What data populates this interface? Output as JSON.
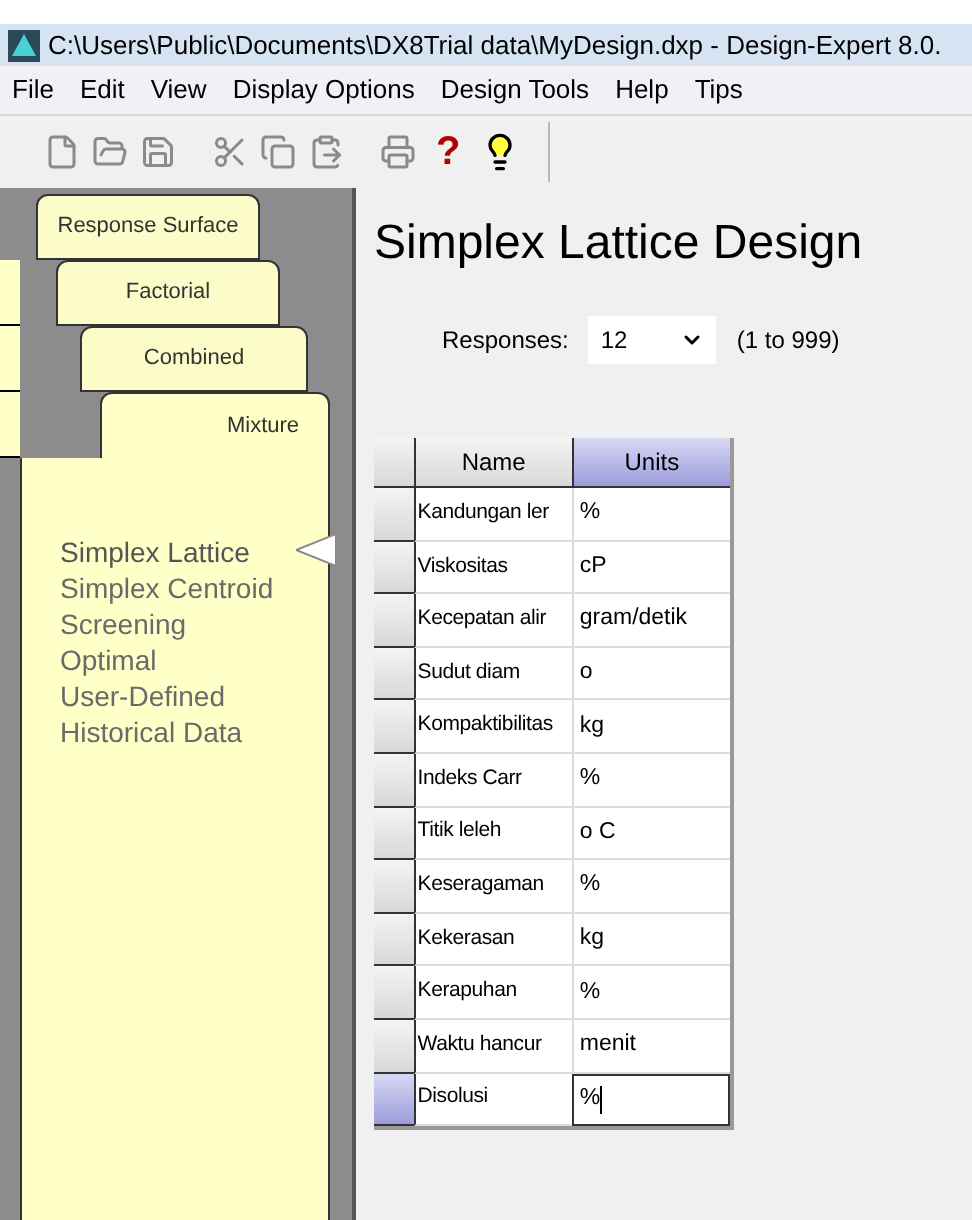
{
  "window": {
    "title": "C:\\Users\\Public\\Documents\\DX8Trial data\\MyDesign.dxp - Design-Expert 8.0."
  },
  "menu": [
    "File",
    "Edit",
    "View",
    "Display Options",
    "Design Tools",
    "Help",
    "Tips"
  ],
  "toolbar": [
    {
      "kind": "new"
    },
    {
      "kind": "open"
    },
    {
      "kind": "save"
    },
    {
      "kind": "cut"
    },
    {
      "kind": "copy"
    },
    {
      "kind": "paste"
    },
    {
      "kind": "print"
    },
    {
      "kind": "help",
      "label": "?"
    },
    {
      "kind": "tip"
    }
  ],
  "tabs": [
    {
      "label": "Response Surface",
      "selected": false
    },
    {
      "label": "Factorial",
      "selected": false
    },
    {
      "label": "Combined",
      "selected": false
    },
    {
      "label": "Mixture",
      "selected": true
    }
  ],
  "design_types": [
    {
      "label": "Simplex Lattice",
      "selected": true
    },
    {
      "label": "Simplex Centroid",
      "selected": false
    },
    {
      "label": "Screening",
      "selected": false
    },
    {
      "label": "Optimal",
      "selected": false
    },
    {
      "label": "User-Defined",
      "selected": false
    },
    {
      "label": "Historical Data",
      "selected": false
    }
  ],
  "heading": "Simplex Lattice Design",
  "responses": {
    "label": "Responses:",
    "value": "12",
    "hint": "(1 to 999)"
  },
  "table": {
    "columns": [
      {
        "label": "Name",
        "selected": false
      },
      {
        "label": "Units",
        "selected": true
      }
    ],
    "rows": [
      {
        "name": "Kandungan ler",
        "units": "%",
        "selected": false
      },
      {
        "name": "Viskositas",
        "units": "cP",
        "selected": false
      },
      {
        "name": "Kecepatan alir",
        "units": "gram/detik",
        "selected": false
      },
      {
        "name": "Sudut diam",
        "units": "o",
        "selected": false
      },
      {
        "name": "Kompaktibilitas",
        "units": "kg",
        "selected": false
      },
      {
        "name": "Indeks Carr",
        "units": "%",
        "selected": false
      },
      {
        "name": "Titik leleh",
        "units": "o C",
        "selected": false
      },
      {
        "name": "Keseragaman",
        "units": "%",
        "selected": false
      },
      {
        "name": "Kekerasan",
        "units": "kg",
        "selected": false
      },
      {
        "name": "Kerapuhan",
        "units": "%",
        "selected": false
      },
      {
        "name": "Waktu hancur",
        "units": "menit",
        "selected": false
      },
      {
        "name": "Disolusi",
        "units": "%",
        "selected": true
      }
    ]
  }
}
